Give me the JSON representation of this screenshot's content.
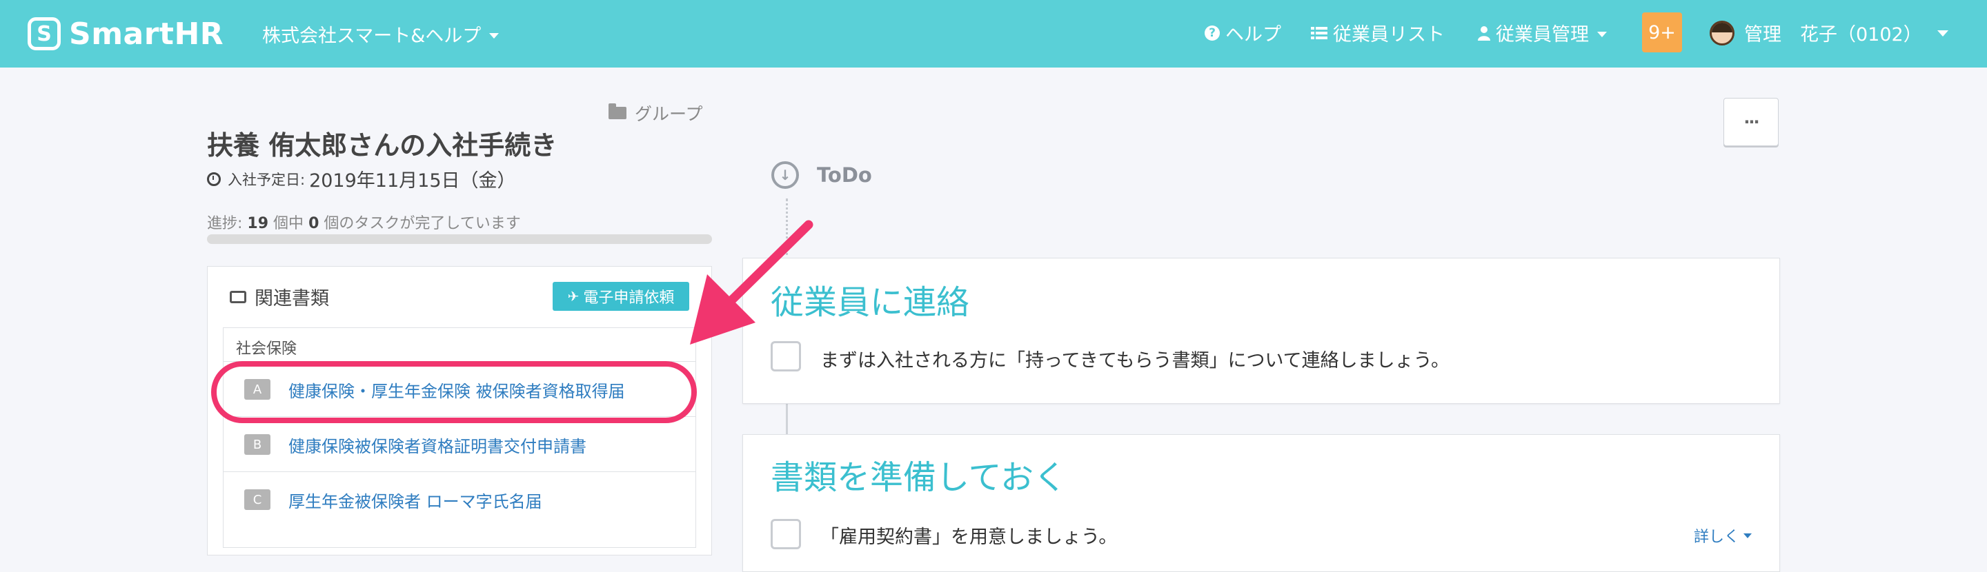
{
  "header": {
    "logo_text": "SmartHR",
    "logo_mark": "S",
    "company": "株式会社スマート&ヘルプ",
    "nav": {
      "help": "ヘルプ",
      "employee_list": "従業員リスト",
      "employee_management": "従業員管理"
    },
    "notification_count": "9+",
    "user_name": "管理　花子（0102）"
  },
  "page": {
    "group_link": "グループ",
    "title": "扶養 侑太郎さんの入社手続き",
    "date_label": "入社予定日:",
    "date_value": "2019年11月15日（金）",
    "progress": {
      "prefix": "進捗:",
      "total": "19",
      "mid": "個中",
      "done": "0",
      "suffix": "個のタスクが完了しています",
      "fraction": 0
    }
  },
  "documents": {
    "title": "関連書類",
    "e_apply_button": "電子申請依頼",
    "group_label": "社会保険",
    "items": [
      {
        "letter": "A",
        "name": "健康保険・厚生年金保険 被保険者資格取得届"
      },
      {
        "letter": "B",
        "name": "健康保険被保険者資格証明書交付申請書"
      },
      {
        "letter": "C",
        "name": "厚生年金被保険者 ローマ字氏名届"
      }
    ]
  },
  "timeline": {
    "more_button": "···",
    "todo_label": "ToDo",
    "tasks": [
      {
        "title": "従業員に連絡",
        "text": "まずは入社される方に「持ってきてもらう書類」について連絡しましょう。"
      },
      {
        "title": "書類を準備しておく",
        "text": "「雇用契約書」を用意しましょう。",
        "detail": "詳しく"
      }
    ]
  },
  "colors": {
    "header_bg": "#5ad0d7",
    "accent": "#3bbfcf",
    "link": "#2f7dc0",
    "badge": "#f8a94d",
    "highlight": "#f1356e"
  }
}
